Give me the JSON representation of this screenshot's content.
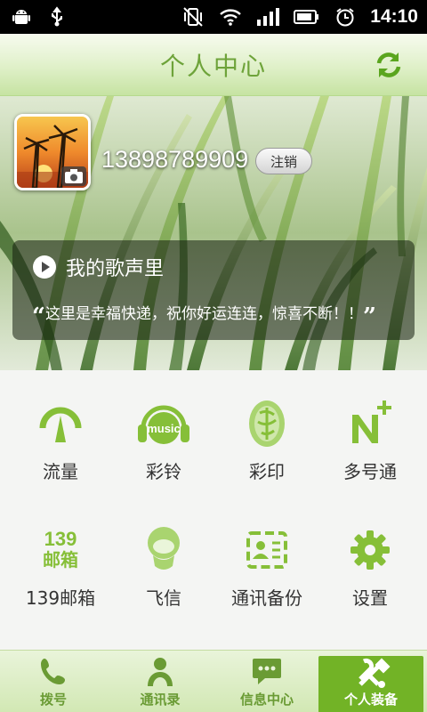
{
  "status_bar": {
    "time": "14:10"
  },
  "header": {
    "title": "个人中心"
  },
  "profile": {
    "phone": "13898789909",
    "logout_label": "注销"
  },
  "song": {
    "title": "我的歌声里",
    "quote": "这里是幸福快递，祝你好运连连，惊喜不断！！"
  },
  "grid": {
    "items": [
      {
        "label": "流量",
        "icon": "gauge-icon"
      },
      {
        "label": "彩铃",
        "icon": "music-headphones-icon"
      },
      {
        "label": "彩印",
        "icon": "seal-stamp-icon"
      },
      {
        "label": "多号通",
        "icon": "n-plus-icon"
      },
      {
        "label": "139邮箱",
        "icon_text_top": "139",
        "icon_text_bottom": "邮箱"
      },
      {
        "label": "飞信",
        "icon": "fetion-icon"
      },
      {
        "label": "通讯备份",
        "icon": "contacts-backup-icon"
      },
      {
        "label": "设置",
        "icon": "gear-icon"
      }
    ]
  },
  "tabbar": {
    "items": [
      {
        "label": "拨号",
        "icon": "phone-icon"
      },
      {
        "label": "通讯录",
        "icon": "person-icon"
      },
      {
        "label": "信息中心",
        "icon": "message-icon"
      },
      {
        "label": "个人装备",
        "icon": "tools-icon"
      }
    ],
    "active_index": 3
  },
  "colors": {
    "accent": "#72b326",
    "icon_green": "#86bf38",
    "title_green": "#6ea33a"
  }
}
